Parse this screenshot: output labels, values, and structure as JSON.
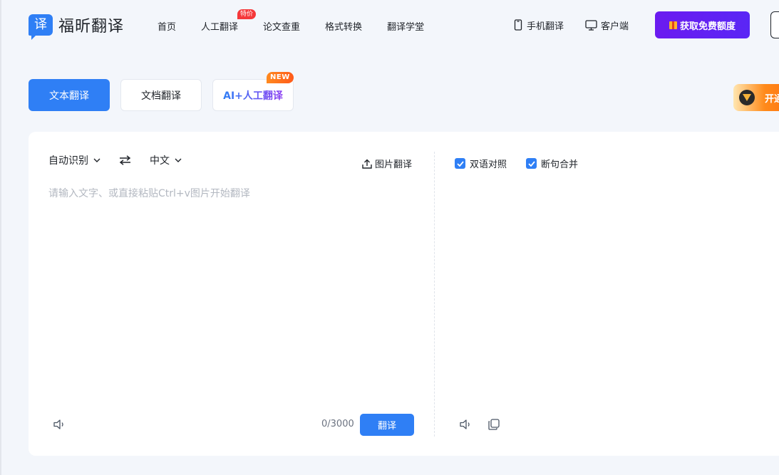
{
  "header": {
    "logo_badge": "译",
    "logo_text": "福昕翻译",
    "nav": [
      {
        "label": "首页"
      },
      {
        "label": "人工翻译",
        "tag": "特价"
      },
      {
        "label": "论文查重"
      },
      {
        "label": "格式转换"
      },
      {
        "label": "翻译学堂"
      }
    ],
    "mobile_label": "手机翻译",
    "desktop_label": "客户端",
    "free_button": "获取免费额度"
  },
  "mode_tabs": {
    "text": "文本翻译",
    "document": "文档翻译",
    "ai_human": "AI+人工翻译",
    "ai_badge": "NEW"
  },
  "promo": {
    "text": "开通"
  },
  "source": {
    "from_lang": "自动识别",
    "to_lang": "中文",
    "image_translate": "图片翻译",
    "placeholder": "请输入文字、或直接粘贴Ctrl+v图片开始翻译",
    "counter": "0/3000",
    "translate_button": "翻译"
  },
  "target": {
    "options": [
      {
        "label": "双语对照",
        "checked": true
      },
      {
        "label": "断句合并",
        "checked": true
      }
    ]
  },
  "colors": {
    "primary": "#2f7ff5",
    "accent_purple": "#6b1bf0",
    "badge_red": "#f5383a",
    "badge_orange": "#ff7a1a"
  }
}
